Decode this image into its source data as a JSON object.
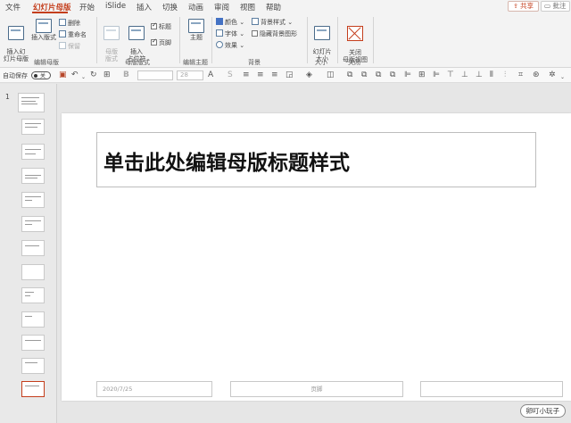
{
  "tabs": [
    {
      "label": "文件",
      "active": false
    },
    {
      "label": "幻灯片母版",
      "active": true
    },
    {
      "label": "开始",
      "active": false
    },
    {
      "label": "iSlide",
      "active": false
    },
    {
      "label": "插入",
      "active": false
    },
    {
      "label": "切换",
      "active": false
    },
    {
      "label": "动画",
      "active": false
    },
    {
      "label": "审阅",
      "active": false
    },
    {
      "label": "视图",
      "active": false
    },
    {
      "label": "帮助",
      "active": false
    }
  ],
  "share_label": "共享",
  "comment_label": "批注",
  "ribbon": {
    "edit_master": {
      "insert_master": "插入幻\n灯片母版",
      "insert_layout": "插入版式",
      "delete": "删除",
      "rename": "重命名",
      "preserve": "保留",
      "group_label": "编辑母版"
    },
    "master_layout": {
      "master_layout_btn": "母版\n版式",
      "insert_placeholder": "插入\n占位符",
      "title_check": "标题",
      "footer_check": "页脚",
      "group_label": "母版版式"
    },
    "edit_theme": {
      "themes": "主题",
      "group_label": "编辑主题"
    },
    "background": {
      "colors": "颜色",
      "fonts": "字体",
      "effects": "效果",
      "bg_styles": "背景样式",
      "hide_bg": "隐藏背景图形",
      "group_label": "背景"
    },
    "size": {
      "slide_size": "幻灯片\n大小",
      "group_label": "大小"
    },
    "close": {
      "close_master": "关闭\n母版视图",
      "group_label": "关闭"
    }
  },
  "qat": {
    "autosave_label": "自动保存",
    "autosave_state": "关",
    "font_name": "",
    "font_size": "28"
  },
  "thumbnail_pane": {
    "slide_number": "1",
    "thumb_count": 13,
    "selected_index": 12
  },
  "slide": {
    "title": "单击此处编辑母版标题样式",
    "date": "2020/7/25",
    "footer": "页脚",
    "number": ""
  },
  "watermark": "卵叮小玩子",
  "colors": {
    "accent": "#c43e1c",
    "ribbon_bg": "#f3f3f3",
    "canvas_bg": "#e6e6e6"
  }
}
